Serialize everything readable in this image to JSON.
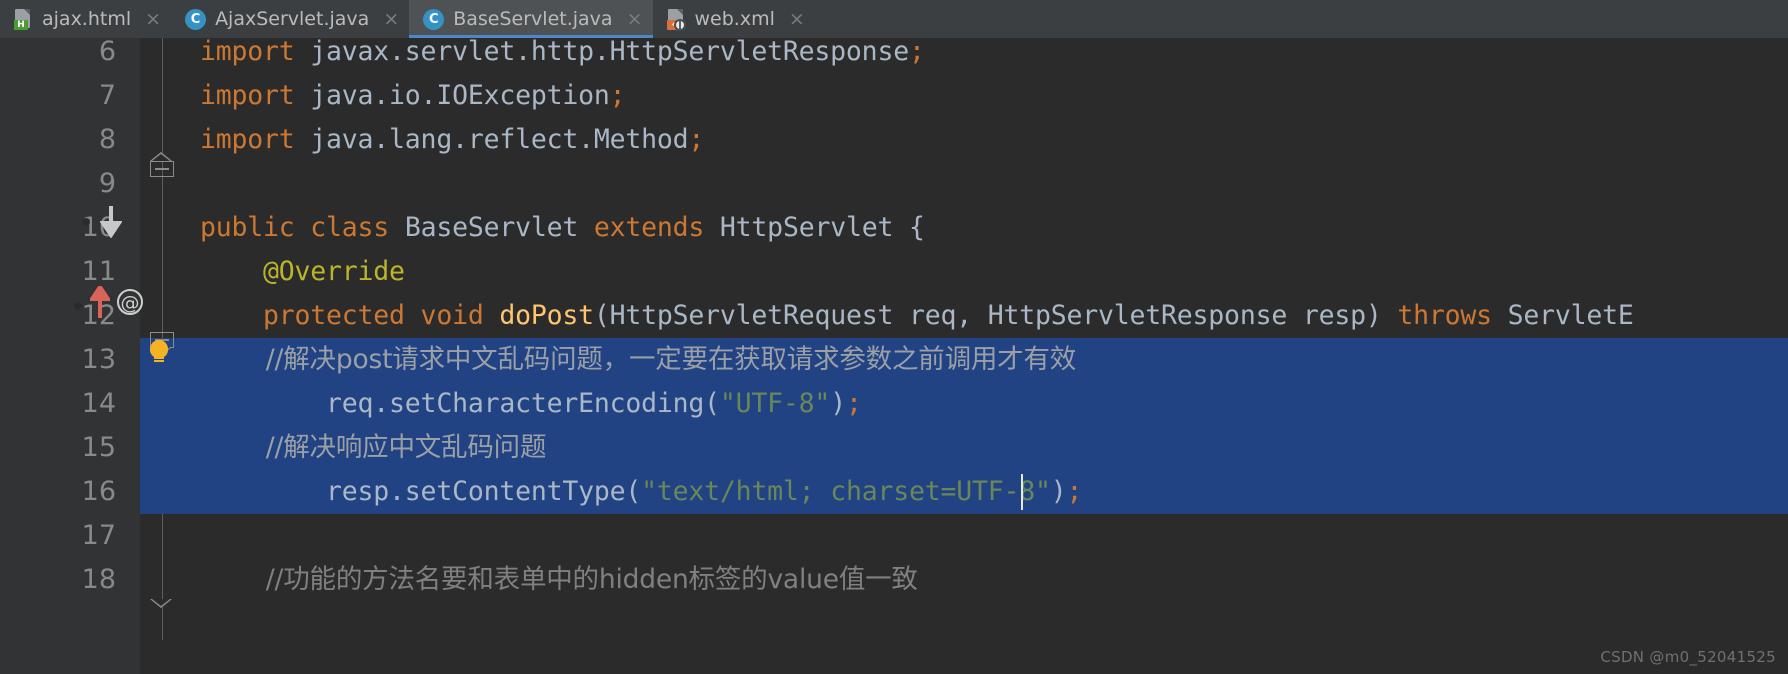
{
  "window": {
    "theme": "darcula",
    "colors": {
      "editor_bg": "#2b2b2b",
      "gutter_bg": "#313335",
      "tabbar_bg": "#3c3f41",
      "active_tab_bg": "#4e5254",
      "active_tab_underline": "#4a88c7",
      "selection_bg": "#214283",
      "keyword": "#cc7832",
      "string": "#6a8759",
      "annotation": "#bbb529",
      "method": "#ffc66d",
      "identifier": "#a9b7c6",
      "comment": "#808080",
      "line_number": "#868a8c"
    }
  },
  "tabs": [
    {
      "label": "ajax.html",
      "icon": "html-file-icon",
      "badge": "H",
      "active": false,
      "closable": true,
      "close_label": "×"
    },
    {
      "label": "AjaxServlet.java",
      "icon": "java-class-icon",
      "badge": "C",
      "active": false,
      "closable": true,
      "close_label": "×"
    },
    {
      "label": "BaseServlet.java",
      "icon": "java-class-icon",
      "badge": "C",
      "active": true,
      "closable": true,
      "close_label": "×"
    },
    {
      "label": "web.xml",
      "icon": "xml-file-icon",
      "badge": "‹",
      "active": false,
      "closable": true,
      "close_label": "×"
    }
  ],
  "editor": {
    "lines": [
      {
        "number": "6",
        "selected": false,
        "tokens": [
          {
            "t": "import ",
            "c": "kw"
          },
          {
            "t": "javax.servlet.http.HttpServletResponse",
            "c": "ident"
          },
          {
            "t": ";",
            "c": "semi"
          }
        ],
        "plain": "import javax.servlet.http.HttpServletResponse;"
      },
      {
        "number": "7",
        "selected": false,
        "tokens": [
          {
            "t": "import ",
            "c": "kw"
          },
          {
            "t": "java.io.IOException",
            "c": "ident"
          },
          {
            "t": ";",
            "c": "semi"
          }
        ],
        "plain": "import java.io.IOException;"
      },
      {
        "number": "8",
        "selected": false,
        "tokens": [
          {
            "t": "import ",
            "c": "kw"
          },
          {
            "t": "java.lang.reflect.Method",
            "c": "ident"
          },
          {
            "t": ";",
            "c": "semi"
          }
        ],
        "plain": "import java.lang.reflect.Method;"
      },
      {
        "number": "9",
        "selected": false,
        "tokens": [],
        "plain": ""
      },
      {
        "number": "10",
        "selected": false,
        "tokens": [
          {
            "t": "public class ",
            "c": "kw"
          },
          {
            "t": "BaseServlet ",
            "c": "ident"
          },
          {
            "t": "extends ",
            "c": "kw"
          },
          {
            "t": "HttpServlet ",
            "c": "ident"
          },
          {
            "t": "{",
            "c": "punc"
          }
        ],
        "plain": "public class BaseServlet extends HttpServlet {"
      },
      {
        "number": "11",
        "selected": false,
        "tokens": [
          {
            "t": "    @Override",
            "c": "anno"
          }
        ],
        "plain": "    @Override"
      },
      {
        "number": "12",
        "selected": false,
        "tokens": [
          {
            "t": "    protected void ",
            "c": "kw"
          },
          {
            "t": "doPost",
            "c": "meth"
          },
          {
            "t": "(",
            "c": "punc"
          },
          {
            "t": "HttpServletRequest req, HttpServletResponse resp",
            "c": "ident"
          },
          {
            "t": ") ",
            "c": "punc"
          },
          {
            "t": "throws ",
            "c": "kw"
          },
          {
            "t": "ServletE",
            "c": "ident"
          }
        ],
        "plain": "    protected void doPost(HttpServletRequest req, HttpServletResponse resp) throws ServletE"
      },
      {
        "number": "13",
        "selected": true,
        "tokens": [
          {
            "t": "        //解决post请求中文乱码问题，一定要在获取请求参数之前调用才有效",
            "c": "cmt-sel cn"
          }
        ],
        "plain": "        //解决post请求中文乱码问题，一定要在获取请求参数之前调用才有效"
      },
      {
        "number": "14",
        "selected": true,
        "tokens": [
          {
            "t": "        req.setCharacterEncoding",
            "c": "ident"
          },
          {
            "t": "(",
            "c": "punc"
          },
          {
            "t": "\"UTF-8\"",
            "c": "str"
          },
          {
            "t": ")",
            "c": "punc"
          },
          {
            "t": ";",
            "c": "semi"
          }
        ],
        "plain": "        req.setCharacterEncoding(\"UTF-8\");"
      },
      {
        "number": "15",
        "selected": true,
        "tokens": [
          {
            "t": "        //解决响应中文乱码问题",
            "c": "cmt-sel cn"
          }
        ],
        "plain": "        //解决响应中文乱码问题"
      },
      {
        "number": "16",
        "selected": true,
        "tokens": [
          {
            "t": "        resp.setContentType",
            "c": "ident"
          },
          {
            "t": "(",
            "c": "punc"
          },
          {
            "t": "\"text/html; charset=UTF-8\"",
            "c": "str"
          },
          {
            "t": ")",
            "c": "punc"
          },
          {
            "t": ";",
            "c": "semi"
          }
        ],
        "plain": "        resp.setContentType(\"text/html; charset=UTF-8\");"
      },
      {
        "number": "17",
        "selected": false,
        "tokens": [],
        "plain": ""
      },
      {
        "number": "18",
        "selected": false,
        "tokens": [
          {
            "t": "        //功能的方法名要和表单中的hidden标签的value值一致",
            "c": "cmt cn"
          }
        ],
        "plain": "        //功能的方法名要和表单中的hidden标签的value值一致"
      }
    ],
    "gutter_markers": {
      "line10": "implemented-method-icon",
      "line12": "overriding-method-icon",
      "line12_annotation": "@",
      "line13": "intention-bulb-icon"
    },
    "selection": {
      "from_line": "13",
      "to_line": "16",
      "caret_after": "resp.setContentType(\"text/html; charset=UTF-8\");"
    }
  },
  "watermark": "CSDN @m0_52041525"
}
